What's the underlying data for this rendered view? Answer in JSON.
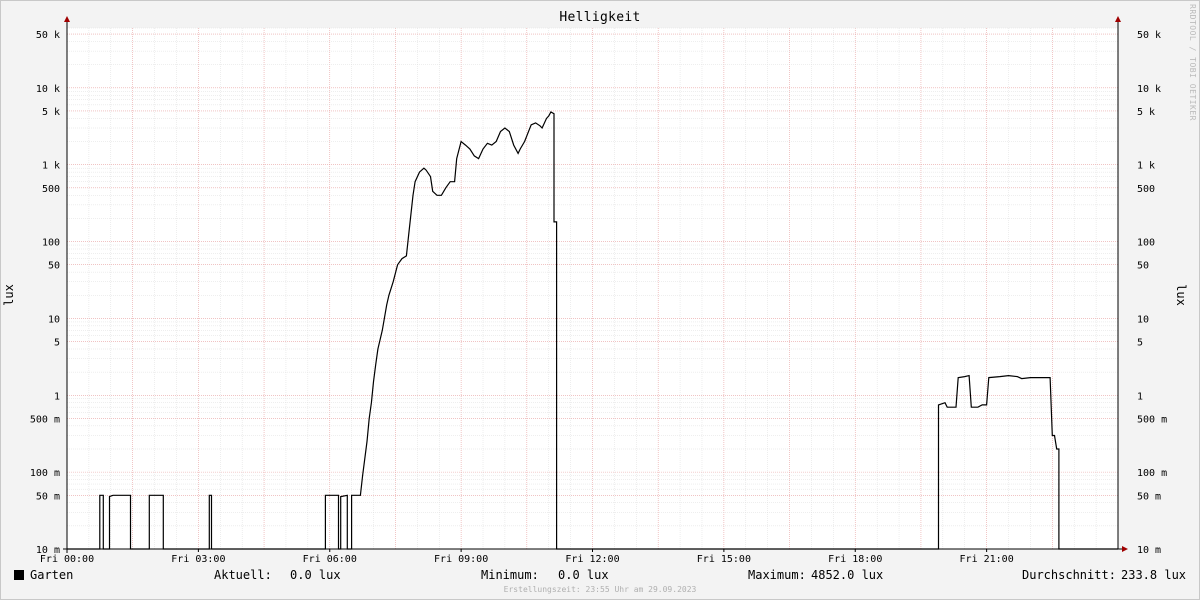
{
  "chart_data": {
    "type": "line",
    "title": "Helligkeit",
    "ylabel": "lux",
    "yscale": "log",
    "ylim": [
      0.01,
      60000
    ],
    "xlim": [
      0,
      24
    ],
    "y_ticks": [
      {
        "value": 0.01,
        "label": "10 m"
      },
      {
        "value": 0.05,
        "label": "50 m"
      },
      {
        "value": 0.1,
        "label": "100 m"
      },
      {
        "value": 0.5,
        "label": "500 m"
      },
      {
        "value": 1,
        "label": "1"
      },
      {
        "value": 5,
        "label": "5"
      },
      {
        "value": 10,
        "label": "10"
      },
      {
        "value": 50,
        "label": "50"
      },
      {
        "value": 100,
        "label": "100"
      },
      {
        "value": 500,
        "label": "500"
      },
      {
        "value": 1000,
        "label": "1 k"
      },
      {
        "value": 5000,
        "label": "5 k"
      },
      {
        "value": 10000,
        "label": "10 k"
      },
      {
        "value": 50000,
        "label": "50 k"
      }
    ],
    "x_ticks": [
      {
        "value": 0,
        "label": "Fri 00:00"
      },
      {
        "value": 3,
        "label": "Fri 03:00"
      },
      {
        "value": 6,
        "label": "Fri 06:00"
      },
      {
        "value": 9,
        "label": "Fri 09:00"
      },
      {
        "value": 12,
        "label": "Fri 12:00"
      },
      {
        "value": 15,
        "label": "Fri 15:00"
      },
      {
        "value": 18,
        "label": "Fri 18:00"
      },
      {
        "value": 21,
        "label": "Fri 21:00"
      }
    ],
    "grid": true,
    "series": [
      {
        "name": "Garten",
        "color": "#000000",
        "points": [
          [
            0,
            0.01
          ],
          [
            0.75,
            0.01
          ],
          [
            0.75,
            0.05
          ],
          [
            0.83,
            0.05
          ],
          [
            0.83,
            0.01
          ],
          [
            0.97,
            0.01
          ],
          [
            0.97,
            0.048
          ],
          [
            1.05,
            0.05
          ],
          [
            1.45,
            0.05
          ],
          [
            1.45,
            0.01
          ],
          [
            1.88,
            0.01
          ],
          [
            1.88,
            0.05
          ],
          [
            2.2,
            0.05
          ],
          [
            2.2,
            0.01
          ],
          [
            3.25,
            0.01
          ],
          [
            3.25,
            0.05
          ],
          [
            3.3,
            0.05
          ],
          [
            3.3,
            0.01
          ],
          [
            5.9,
            0.01
          ],
          [
            5.9,
            0.05
          ],
          [
            6.2,
            0.05
          ],
          [
            6.2,
            0.01
          ],
          [
            6.25,
            0.01
          ],
          [
            6.25,
            0.048
          ],
          [
            6.4,
            0.05
          ],
          [
            6.4,
            0.01
          ],
          [
            6.5,
            0.01
          ],
          [
            6.5,
            0.05
          ],
          [
            6.6,
            0.05
          ],
          [
            6.7,
            0.05
          ],
          [
            6.75,
            0.09
          ],
          [
            6.85,
            0.25
          ],
          [
            6.9,
            0.5
          ],
          [
            6.95,
            0.8
          ],
          [
            7.0,
            1.5
          ],
          [
            7.05,
            2.5
          ],
          [
            7.1,
            4
          ],
          [
            7.2,
            7
          ],
          [
            7.3,
            15
          ],
          [
            7.35,
            20
          ],
          [
            7.45,
            30
          ],
          [
            7.55,
            50
          ],
          [
            7.65,
            60
          ],
          [
            7.75,
            65
          ],
          [
            7.8,
            120
          ],
          [
            7.9,
            400
          ],
          [
            7.95,
            600
          ],
          [
            8.05,
            800
          ],
          [
            8.15,
            900
          ],
          [
            8.2,
            850
          ],
          [
            8.3,
            700
          ],
          [
            8.35,
            450
          ],
          [
            8.45,
            400
          ],
          [
            8.55,
            400
          ],
          [
            8.65,
            500
          ],
          [
            8.75,
            600
          ],
          [
            8.85,
            600
          ],
          [
            8.9,
            1200
          ],
          [
            9.0,
            2000
          ],
          [
            9.1,
            1800
          ],
          [
            9.2,
            1600
          ],
          [
            9.3,
            1300
          ],
          [
            9.4,
            1200
          ],
          [
            9.5,
            1600
          ],
          [
            9.6,
            1900
          ],
          [
            9.7,
            1800
          ],
          [
            9.8,
            2000
          ],
          [
            9.9,
            2700
          ],
          [
            10.0,
            3000
          ],
          [
            10.1,
            2700
          ],
          [
            10.2,
            1800
          ],
          [
            10.3,
            1400
          ],
          [
            10.35,
            1600
          ],
          [
            10.45,
            2000
          ],
          [
            10.55,
            2800
          ],
          [
            10.6,
            3300
          ],
          [
            10.7,
            3500
          ],
          [
            10.8,
            3200
          ],
          [
            10.85,
            3000
          ],
          [
            10.95,
            4000
          ],
          [
            11.0,
            4300
          ],
          [
            11.05,
            4852
          ],
          [
            11.12,
            4600
          ],
          [
            11.12,
            180
          ],
          [
            11.18,
            180
          ],
          [
            11.18,
            0.01
          ],
          [
            19.9,
            0.01
          ],
          [
            19.9,
            0.75
          ],
          [
            20.05,
            0.8
          ],
          [
            20.1,
            0.7
          ],
          [
            20.3,
            0.7
          ],
          [
            20.35,
            1.7
          ],
          [
            20.5,
            1.75
          ],
          [
            20.6,
            1.8
          ],
          [
            20.65,
            0.7
          ],
          [
            20.8,
            0.7
          ],
          [
            20.9,
            0.75
          ],
          [
            21.0,
            0.75
          ],
          [
            21.05,
            1.7
          ],
          [
            21.3,
            1.75
          ],
          [
            21.5,
            1.8
          ],
          [
            21.7,
            1.75
          ],
          [
            21.8,
            1.65
          ],
          [
            22.0,
            1.7
          ],
          [
            22.2,
            1.7
          ],
          [
            22.45,
            1.7
          ],
          [
            22.5,
            0.3
          ],
          [
            22.55,
            0.3
          ],
          [
            22.6,
            0.2
          ],
          [
            22.65,
            0.2
          ],
          [
            22.65,
            0.01
          ],
          [
            24,
            0.01
          ]
        ]
      }
    ]
  },
  "legend": {
    "series_name": "Garten",
    "current_label": "Aktuell:",
    "current_value": "0.0 lux",
    "min_label": "Minimum:",
    "min_value": "0.0 lux",
    "max_label": "Maximum:",
    "max_value": "4852.0 lux",
    "avg_label": "Durchschnitt:",
    "avg_value": "233.8 lux"
  },
  "footer": "Erstellungszeit: 23:55 Uhr am 29.09.2023",
  "credit": "RRDTOOL / TOBI OETIKER"
}
